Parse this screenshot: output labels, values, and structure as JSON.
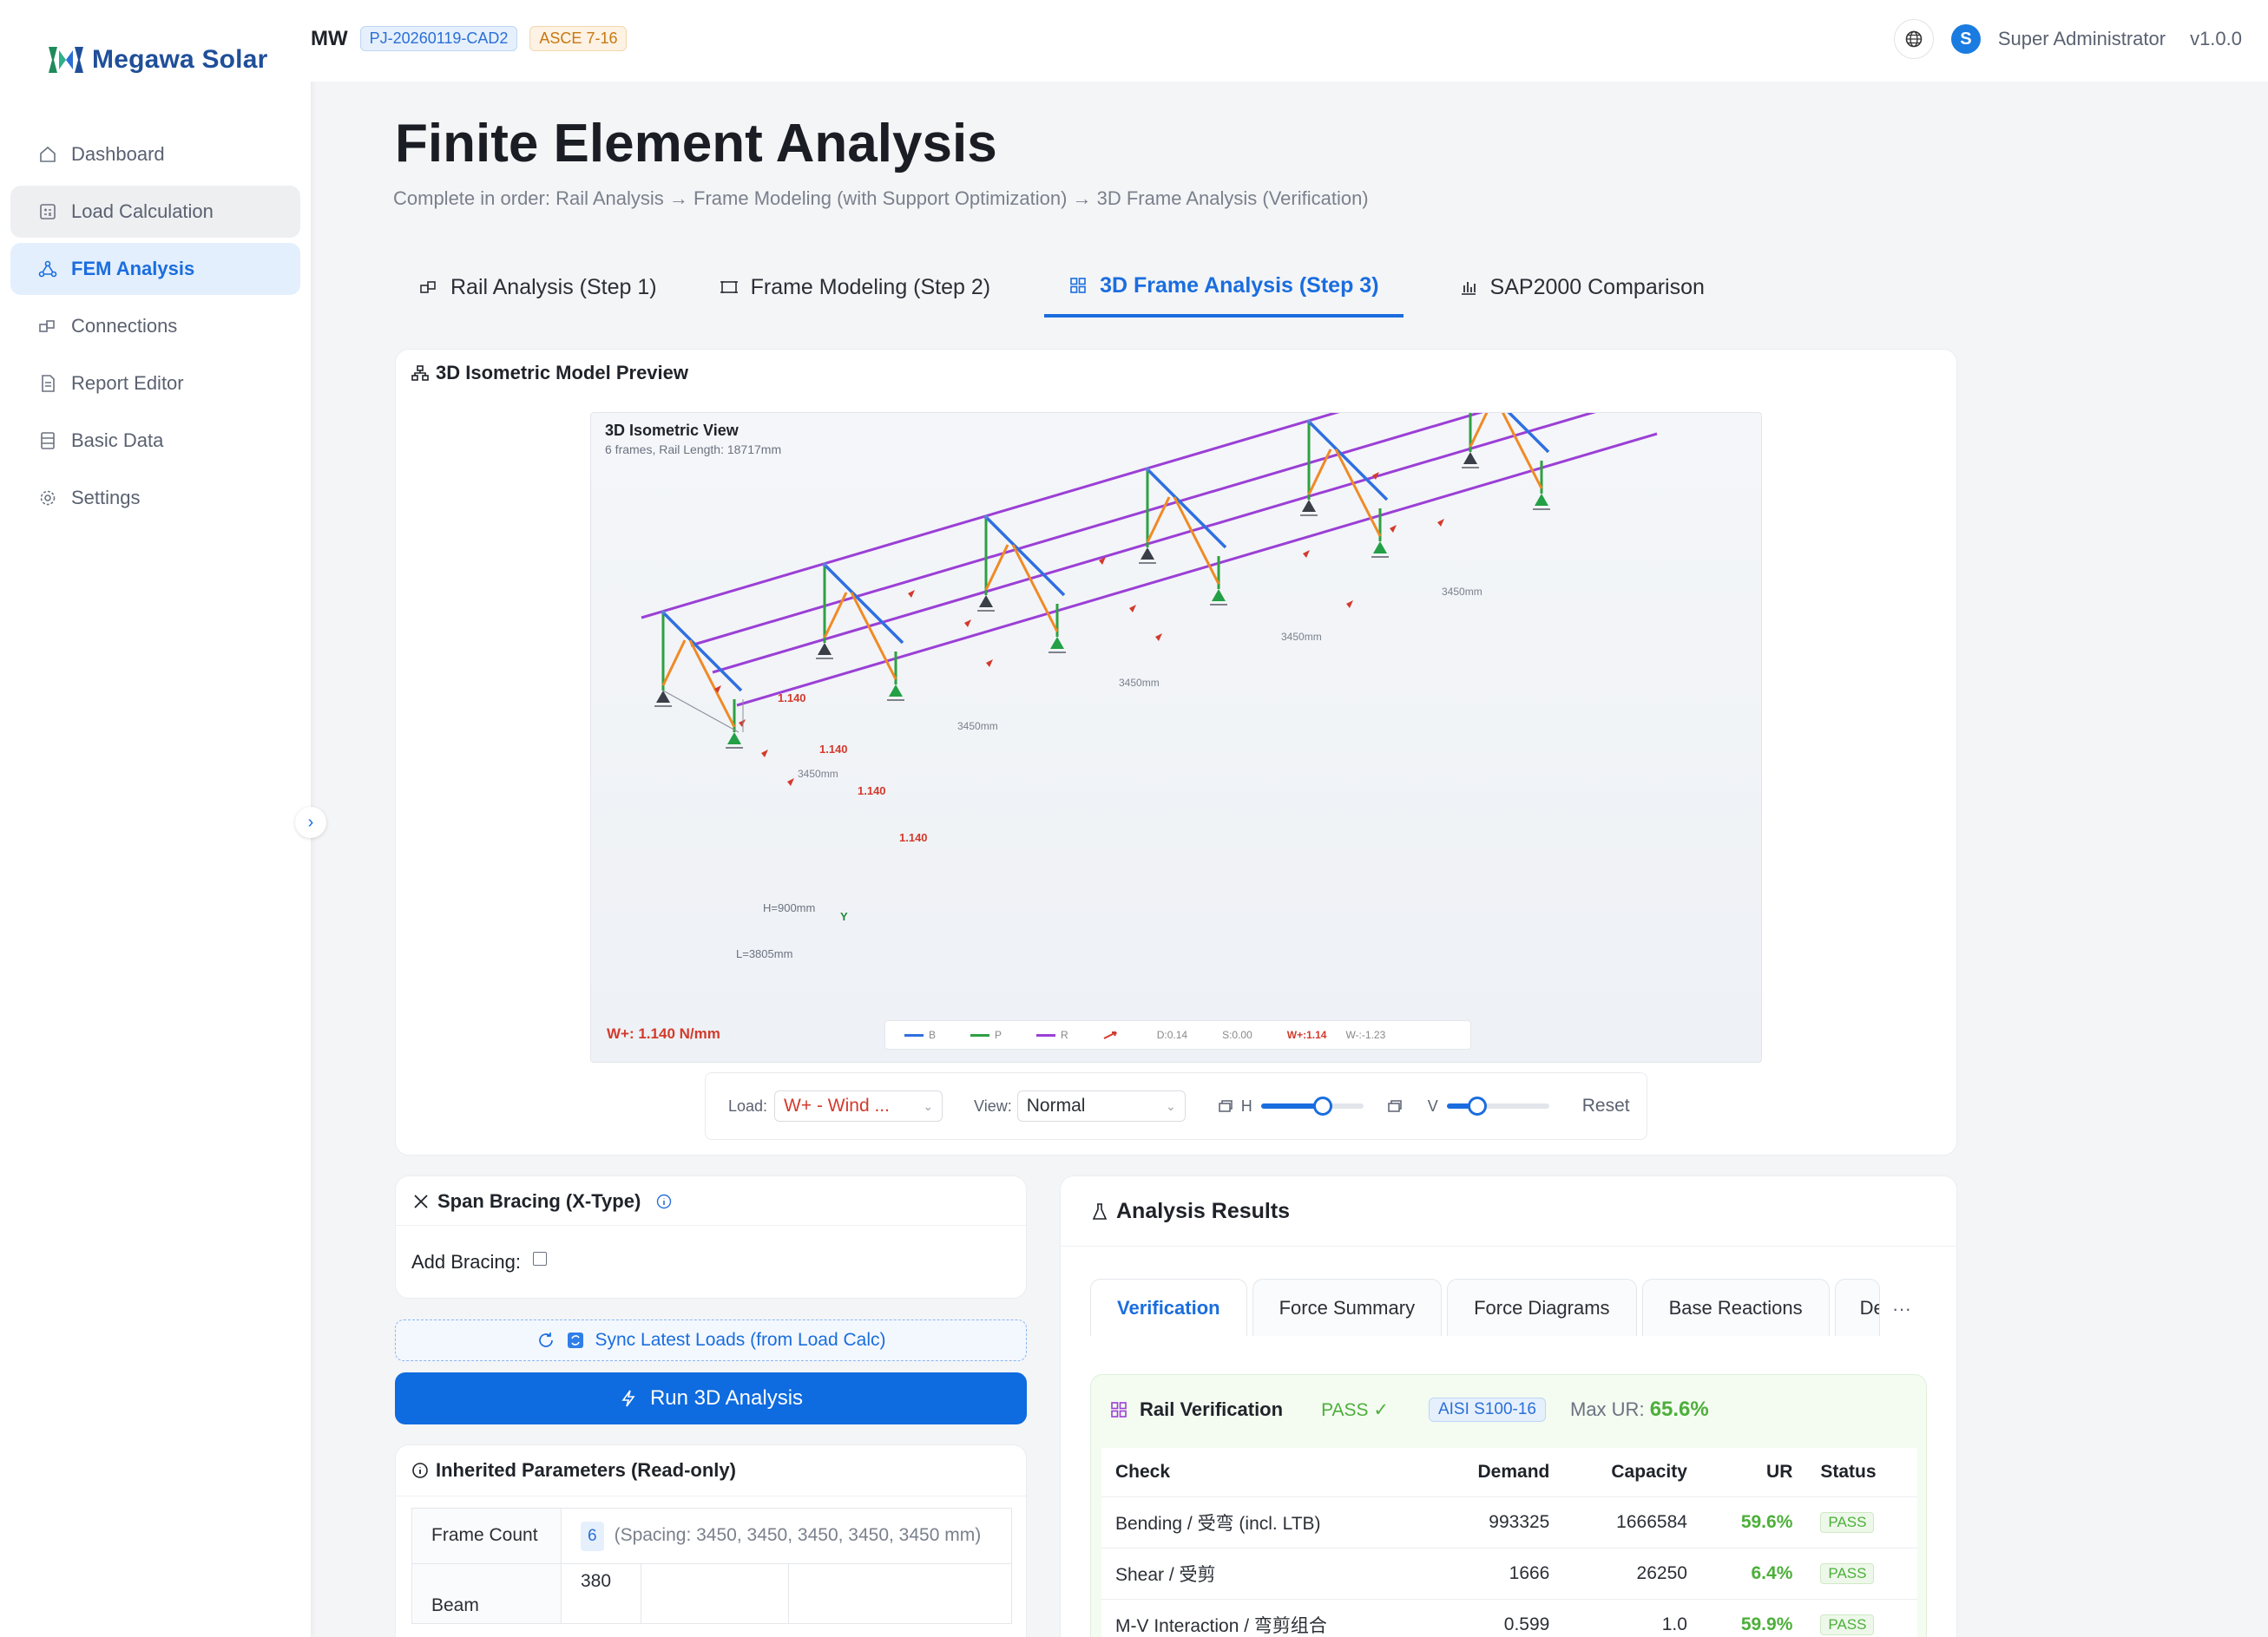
{
  "app": {
    "logo_text": "Megawa Solar",
    "colors": {
      "accent": "#1a6dde",
      "pass": "#4caf3a",
      "wind": "#d33a2c"
    }
  },
  "header": {
    "project_name": "MW",
    "project_id": "PJ-20260119-CAD2",
    "standard": "ASCE 7-16",
    "avatar_letter": "S",
    "user_name": "Super Administrator",
    "version": "v1.0.0"
  },
  "sidebar": {
    "items": [
      {
        "label": "Dashboard",
        "icon": "home-icon"
      },
      {
        "label": "Load Calculation",
        "icon": "calculator-icon"
      },
      {
        "label": "FEM Analysis",
        "icon": "network-icon"
      },
      {
        "label": "Connections",
        "icon": "connections-icon"
      },
      {
        "label": "Report Editor",
        "icon": "document-icon"
      },
      {
        "label": "Basic Data",
        "icon": "database-icon"
      },
      {
        "label": "Settings",
        "icon": "gear-icon"
      }
    ]
  },
  "page": {
    "title": "Finite Element Analysis",
    "subtitle": "Complete in order: Rail Analysis → Frame Modeling (with Support Optimization) → 3D Frame Analysis (Verification)"
  },
  "tabs": [
    {
      "label": "Rail Analysis (Step 1)"
    },
    {
      "label": "Frame Modeling (Step 2)"
    },
    {
      "label": "3D Frame Analysis (Step 3)"
    },
    {
      "label": "SAP2000 Comparison"
    }
  ],
  "preview": {
    "card_title": "3D Isometric Model Preview",
    "canvas_title": "3D Isometric View",
    "canvas_subtitle": "6 frames, Rail Length: 18717mm",
    "wind_label": "W+: 1.140 N/mm",
    "spacing_label": "3450mm",
    "load_value_label": "1.140",
    "height_label": "H=900mm",
    "length_label": "L=3805mm",
    "axis_y": "Y",
    "legend": {
      "b": "B",
      "p": "P",
      "r": "R",
      "d": "D:0.14",
      "s": "S:0.00",
      "wp": "W+:1.14",
      "wm": "W-:-1.23"
    }
  },
  "controls": {
    "load_label": "Load:",
    "load_value": "W+ - Wind ...",
    "view_label": "View:",
    "view_value": "Normal",
    "h_label": "H",
    "v_label": "V",
    "h_level": 0.6,
    "v_level": 0.3,
    "reset_label": "Reset"
  },
  "bracing": {
    "title": "Span Bracing (X-Type)",
    "add_label": "Add Bracing:"
  },
  "actions": {
    "sync_label": "Sync Latest Loads (from Load Calc)",
    "run_label": "Run 3D Analysis"
  },
  "inherited": {
    "title": "Inherited Parameters (Read-only)",
    "frame_count_label": "Frame Count",
    "frame_count": "6",
    "spacing_text": "(Spacing: 3450, 3450, 3450, 3450, 3450 mm)",
    "beam_label": "Beam",
    "beam_value": "380"
  },
  "results": {
    "title": "Analysis Results",
    "tabs": [
      "Verification",
      "Force Summary",
      "Force Diagrams",
      "Base Reactions",
      "De"
    ],
    "more": "···",
    "rail": {
      "title": "Rail Verification",
      "pass": "PASS ✓",
      "standard": "AISI S100-16",
      "max_ur_label": "Max UR:",
      "max_ur": "65.6%",
      "columns": [
        "Check",
        "Demand",
        "Capacity",
        "UR",
        "Status"
      ],
      "rows": [
        {
          "check": "Bending / 受弯 (incl. LTB)",
          "demand": "993325",
          "capacity": "1666584",
          "ur": "59.6%",
          "status": "PASS"
        },
        {
          "check": "Shear / 受剪",
          "demand": "1666",
          "capacity": "26250",
          "ur": "6.4%",
          "status": "PASS"
        },
        {
          "check": "M-V Interaction / 弯剪组合",
          "demand": "0.599",
          "capacity": "1.0",
          "ur": "59.9%",
          "status": "PASS"
        }
      ]
    }
  }
}
